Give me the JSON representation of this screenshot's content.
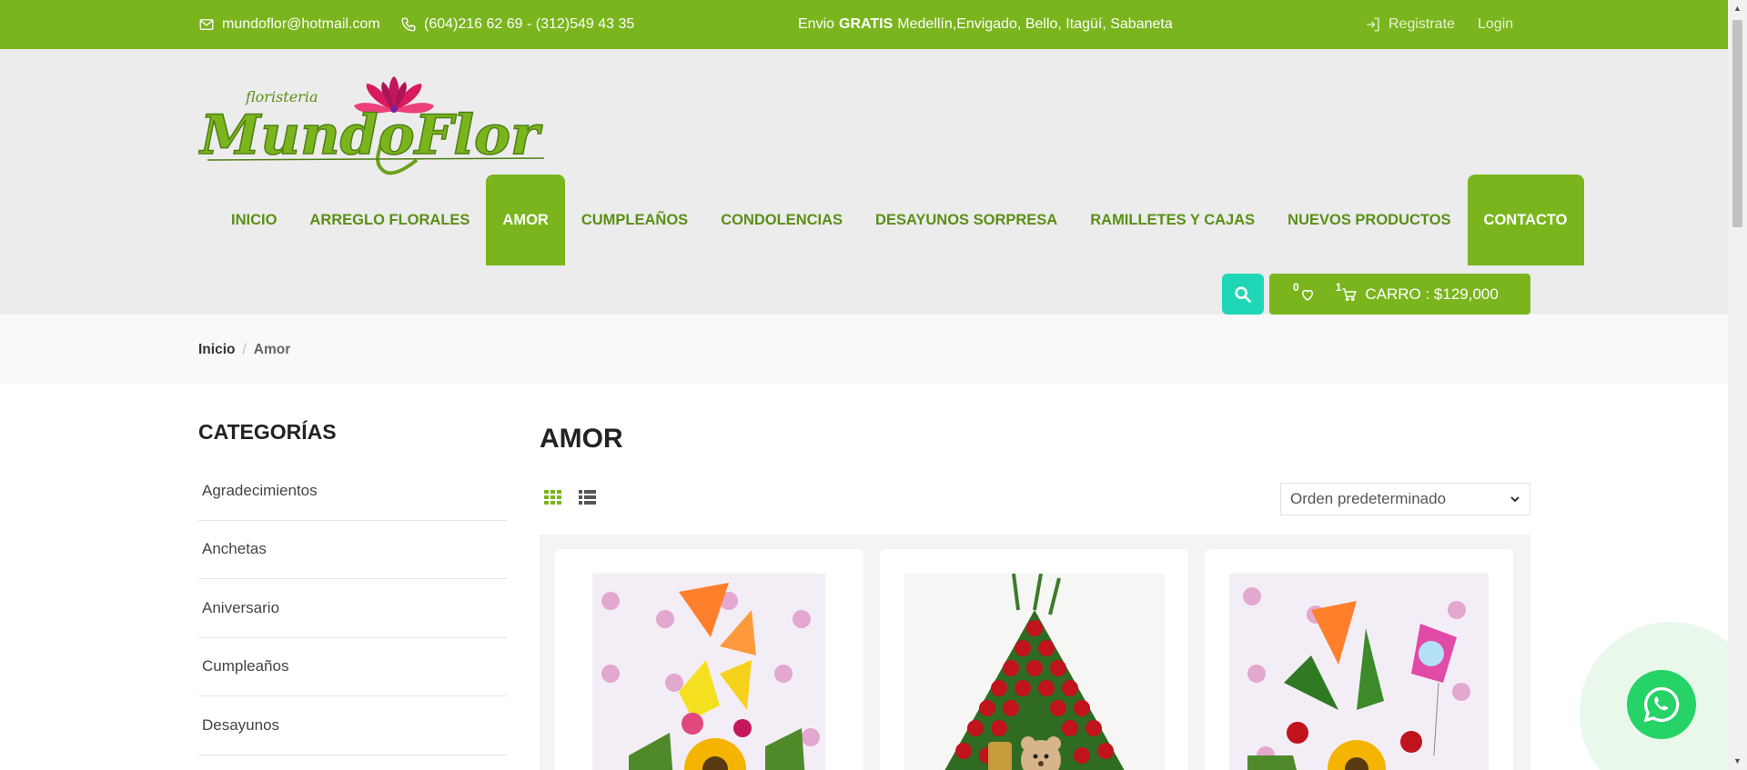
{
  "topbar": {
    "email": "mundoflor@hotmail.com",
    "phone": "(604)216 62 69 - (312)549 43 35",
    "shipping_prefix": "Envio",
    "shipping_bold": "GRATIS",
    "shipping_rest": "Medellín,Envigado, Bello, Itagüí, Sabaneta",
    "register": "Registrate",
    "login": "Login"
  },
  "logo": {
    "small_text": "floristeria",
    "text": "MundoFlor"
  },
  "nav": [
    {
      "label": "INICIO",
      "active": false
    },
    {
      "label": "ARREGLO FLORALES",
      "active": false
    },
    {
      "label": "AMOR",
      "active": true
    },
    {
      "label": "CUMPLEAÑOS",
      "active": false
    },
    {
      "label": "CONDOLENCIAS",
      "active": false
    },
    {
      "label": "DESAYUNOS SORPRESA",
      "active": false
    },
    {
      "label": "RAMILLETES Y CAJAS",
      "active": false
    },
    {
      "label": "NUEVOS PRODUCTOS",
      "active": false
    },
    {
      "label": "CONTACTO",
      "active": true
    }
  ],
  "cart": {
    "wishlist_count": "0",
    "cart_count": "1",
    "label": "CARRO : $129,000"
  },
  "breadcrumb": {
    "home": "Inicio",
    "separator": "/",
    "current": "Amor"
  },
  "sidebar": {
    "title": "CATEGORÍAS",
    "items": [
      "Agradecimientos",
      "Anchetas",
      "Aniversario",
      "Cumpleaños",
      "Desayunos"
    ]
  },
  "main": {
    "title": "AMOR",
    "sort_selected": "Orden predeterminado"
  },
  "icons": {
    "email": "envelope-icon",
    "phone": "phone-icon",
    "register": "login-icon",
    "search": "search-icon",
    "wishlist": "heart-icon",
    "cart": "cart-icon",
    "grid": "grid-view-icon",
    "list": "list-view-icon",
    "whatsapp": "whatsapp-icon"
  },
  "colors": {
    "brand_green": "#7ab51d",
    "nav_text": "#5a8f16",
    "search_teal": "#1fd6b6",
    "whatsapp": "#25d366"
  }
}
